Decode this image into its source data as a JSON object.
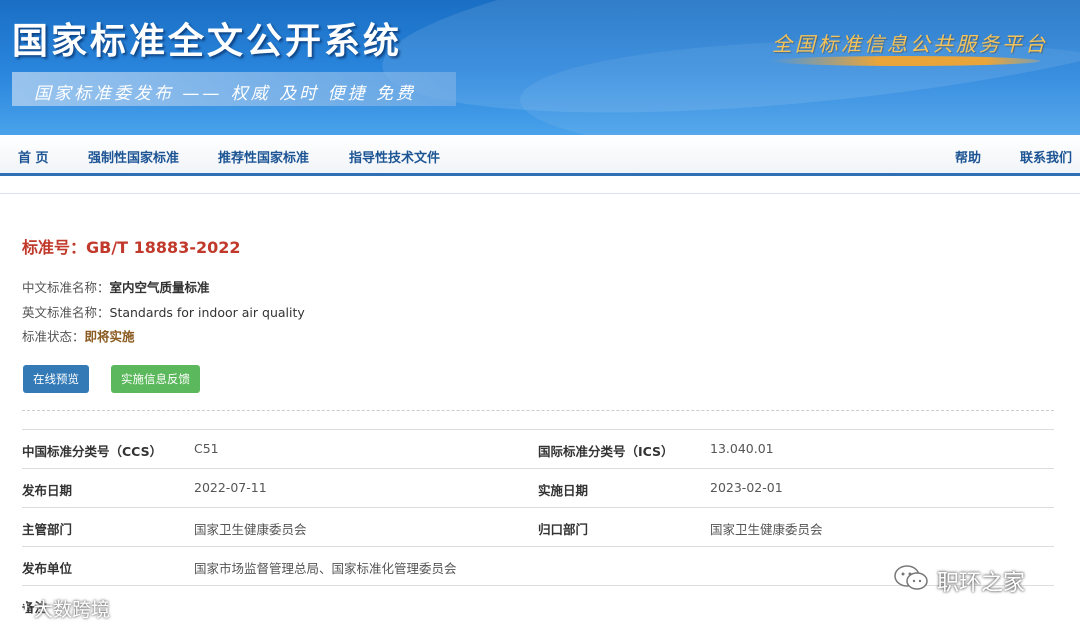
{
  "header": {
    "site_title": "国家标准全文公开系统",
    "tagline": "国家标准委发布 —— 权威 及时 便捷 免费",
    "platform": "全国标准信息公共服务平台"
  },
  "nav": {
    "left": [
      "首 页",
      "强制性国家标准",
      "推荐性国家标准",
      "指导性技术文件"
    ],
    "right": [
      "帮助",
      "联系我们"
    ]
  },
  "standard": {
    "number_label": "标准号：GB/T 18883-2022",
    "cn_name_label": "中文标准名称：",
    "cn_name": "室内空气质量标准",
    "en_name_label": "英文标准名称：",
    "en_name": "Standards for indoor air quality",
    "status_label": "标准状态：",
    "status": "即将实施"
  },
  "buttons": {
    "preview": "在线预览",
    "feedback": "实施信息反馈"
  },
  "details": [
    {
      "l1": "中国标准分类号（CCS）",
      "v1": "C51",
      "l2": "国际标准分类号（ICS）",
      "v2": "13.040.01"
    },
    {
      "l1": "发布日期",
      "v1": "2022-07-11",
      "l2": "实施日期",
      "v2": "2023-02-01"
    },
    {
      "l1": "主管部门",
      "v1": "国家卫生健康委员会",
      "l2": "归口部门",
      "v2": "国家卫生健康委员会"
    },
    {
      "l1": "发布单位",
      "v1": "国家市场监督管理总局、国家标准化管理委员会",
      "l2": "",
      "v2": ""
    },
    {
      "l1": "备注",
      "v1": "",
      "l2": "",
      "v2": ""
    }
  ],
  "watermarks": {
    "right": "职环之家",
    "left": "大数跨境"
  },
  "colors": {
    "banner": "#2a86dd",
    "nav_text": "#1d5594",
    "std_number": "#c0392b",
    "btn_preview": "#337ab7",
    "btn_feedback": "#5cb85c"
  }
}
